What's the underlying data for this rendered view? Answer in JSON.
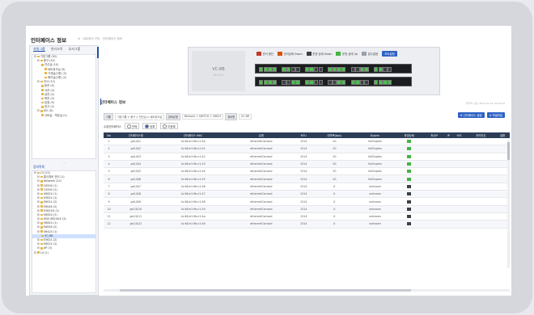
{
  "page": {
    "title": "인터페이스 정보",
    "breadcrumb": "# · 네트워크 관리 · 인터페이스 정보"
  },
  "left": {
    "tabs": [
      "자원그룹",
      "관리조직",
      "부서그룹"
    ],
    "tree": [
      {
        "label": "기본그룹 (92)",
        "indent": 0
      },
      {
        "label": "중구 (42)",
        "indent": 1
      },
      {
        "label": "전산실 (10)",
        "indent": 2
      },
      {
        "label": "네트워크실 (5)",
        "indent": 3
      },
      {
        "label": "기계실(1층) (3)",
        "indent": 3
      },
      {
        "label": "회의실(2층) (2)",
        "indent": 3
      },
      {
        "label": "지사 (12)",
        "indent": 1
      },
      {
        "label": "동관 (4)",
        "indent": 2
      },
      {
        "label": "서관 (3)",
        "indent": 2
      },
      {
        "label": "남관 (2)",
        "indent": 2
      },
      {
        "label": "북관 (3)",
        "indent": 2
      },
      {
        "label": "분점 (5)",
        "indent": 2
      },
      {
        "label": "창고 (2)",
        "indent": 2
      },
      {
        "label": "IDC (8)",
        "indent": 1
      },
      {
        "label": "서버실 · 백본실 (2)",
        "indent": 2
      }
    ],
    "subhead": "장비목록",
    "tree2": [
      {
        "label": "L3 (12)",
        "indent": 0
      },
      {
        "label": "통신장비 관리 (1)",
        "indent": 1
      },
      {
        "label": "Network (22)",
        "indent": 1
      },
      {
        "label": "C6500 (1)",
        "indent": 1
      },
      {
        "label": "C4500 (2)",
        "indent": 1
      },
      {
        "label": "V6824 (1)",
        "indent": 1
      },
      {
        "label": "E5624 (1)",
        "indent": 1
      },
      {
        "label": "E6024 (2)",
        "indent": 1
      },
      {
        "label": "E6048 (2)",
        "indent": 1
      },
      {
        "label": "E5624G (1)",
        "indent": 1
      },
      {
        "label": "V6824 (2)",
        "indent": 1
      },
      {
        "label": "HDS 6824GX (3)",
        "indent": 1
      },
      {
        "label": "V6824 (1)",
        "indent": 1
      },
      {
        "label": "E6048 (2)",
        "indent": 1
      },
      {
        "label": "V6424 (1)",
        "indent": 1
      },
      {
        "label": "VC-8B",
        "indent": 2,
        "sel": true
      },
      {
        "label": "E5624 (2)",
        "indent": 1
      },
      {
        "label": "E6024 (1)",
        "indent": 1
      },
      {
        "label": "AP (3)",
        "indent": 1
      },
      {
        "label": "L4 (1)",
        "indent": 0
      }
    ]
  },
  "device": {
    "name": "VC-8B",
    "sub": "10.0.0.1",
    "legend": [
      {
        "label": "관리 중단",
        "color": "#c0392b"
      },
      {
        "label": "관리상태 Down",
        "color": "#d35400"
      },
      {
        "label": "운영 상태 Down",
        "color": "#3a3f48"
      },
      {
        "label": "운영 상태 Up",
        "color": "#43b443"
      },
      {
        "label": "알수없음",
        "color": "#9aa0aa"
      }
    ],
    "legend_button": "포트설정"
  },
  "section": {
    "title": "인터페이스 정보",
    "note": "마지막 수집: 2023.01.01 10:00:00"
  },
  "filter": {
    "group_label": "그룹",
    "group_value": "기본그룹 > 중구 > 전산실 > 네트워크실",
    "category_label": "장비유형",
    "category_value": "Network > SWITCH > V6824",
    "device_label": "장비명",
    "device_value": "VC-8B"
  },
  "buttons": {
    "settings": "인터페이스 설정",
    "excel": "엑셀파일"
  },
  "radios": {
    "label": "수집인터페이스",
    "options": [
      "전체",
      "등록",
      "미등록"
    ],
    "selected": 1
  },
  "table": {
    "headers": [
      "No",
      "인터페이스명",
      "인터페이스 MAC",
      "유형",
      "MTU",
      "대역폭(bps)",
      "Duplex",
      "운영상태",
      "최신IP",
      "IP",
      "속도",
      "관리번호",
      "설명"
    ],
    "rows": [
      {
        "no": "1",
        "name": "ge1/0/1",
        "mac": "4c:60:e1:9b:c1:40",
        "type": "ethernetCsmacd",
        "mtu": "1514",
        "bw": "1G",
        "duplex": "fullDuplex",
        "status": "up"
      },
      {
        "no": "2",
        "name": "ge1/0/2",
        "mac": "4c:60:e1:9b:c1:41",
        "type": "ethernetCsmacd",
        "mtu": "1514",
        "bw": "1G",
        "duplex": "fullDuplex",
        "status": "up"
      },
      {
        "no": "3",
        "name": "ge1/0/3",
        "mac": "4c:60:e1:9b:c1:42",
        "type": "ethernetCsmacd",
        "mtu": "1514",
        "bw": "1G",
        "duplex": "fullDuplex",
        "status": "up"
      },
      {
        "no": "4",
        "name": "ge1/0/4",
        "mac": "4c:60:e1:9b:c1:43",
        "type": "ethernetCsmacd",
        "mtu": "1514",
        "bw": "1G",
        "duplex": "fullDuplex",
        "status": "up"
      },
      {
        "no": "5",
        "name": "ge1/0/5",
        "mac": "4c:60:e1:9b:c1:44",
        "type": "ethernetCsmacd",
        "mtu": "1514",
        "bw": "1G",
        "duplex": "fullDuplex",
        "status": "up"
      },
      {
        "no": "6",
        "name": "ge1/0/6",
        "mac": "4c:60:e1:9b:c1:45",
        "type": "ethernetCsmacd",
        "mtu": "1514",
        "bw": "1G",
        "duplex": "fullDuplex",
        "status": "up"
      },
      {
        "no": "7",
        "name": "ge1/0/7",
        "mac": "4c:60:e1:9b:c1:46",
        "type": "ethernetCsmacd",
        "mtu": "1514",
        "bw": "0",
        "duplex": "unknown",
        "status": "down"
      },
      {
        "no": "8",
        "name": "ge1/0/8",
        "mac": "4c:60:e1:9b:c1:47",
        "type": "ethernetCsmacd",
        "mtu": "1514",
        "bw": "0",
        "duplex": "unknown",
        "status": "down"
      },
      {
        "no": "9",
        "name": "ge1/0/9",
        "mac": "4c:60:e1:9b:c1:48",
        "type": "ethernetCsmacd",
        "mtu": "1514",
        "bw": "0",
        "duplex": "unknown",
        "status": "down"
      },
      {
        "no": "10",
        "name": "ge1/0/10",
        "mac": "4c:60:e1:9b:c1:49",
        "type": "ethernetCsmacd",
        "mtu": "1514",
        "bw": "0",
        "duplex": "unknown",
        "status": "down"
      },
      {
        "no": "11",
        "name": "ge1/0/11",
        "mac": "4c:60:e1:9b:c1:4a",
        "type": "ethernetCsmacd",
        "mtu": "1514",
        "bw": "0",
        "duplex": "unknown",
        "status": "down"
      },
      {
        "no": "12",
        "name": "ge1/0/12",
        "mac": "4c:60:e1:9b:c1:4b",
        "type": "ethernetCsmacd",
        "mtu": "1514",
        "bw": "0",
        "duplex": "unknown",
        "status": "down"
      }
    ]
  },
  "colors": {
    "header_bg": "#2c3d57",
    "accent": "#2e62c4",
    "status_up": "#43b443",
    "status_down": "#3a3f48"
  },
  "rack_ports": {
    "row1": [
      1,
      1,
      1,
      1,
      1,
      1,
      0,
      0,
      1,
      1,
      0,
      0,
      1,
      1,
      1,
      1,
      0,
      0,
      1,
      1,
      1,
      1,
      0,
      0
    ],
    "row2": [
      1,
      1,
      1,
      1,
      0,
      0,
      1,
      1,
      1,
      1,
      0,
      0,
      0,
      0,
      1,
      1,
      1,
      1,
      0,
      0,
      1,
      1,
      1,
      1
    ]
  }
}
